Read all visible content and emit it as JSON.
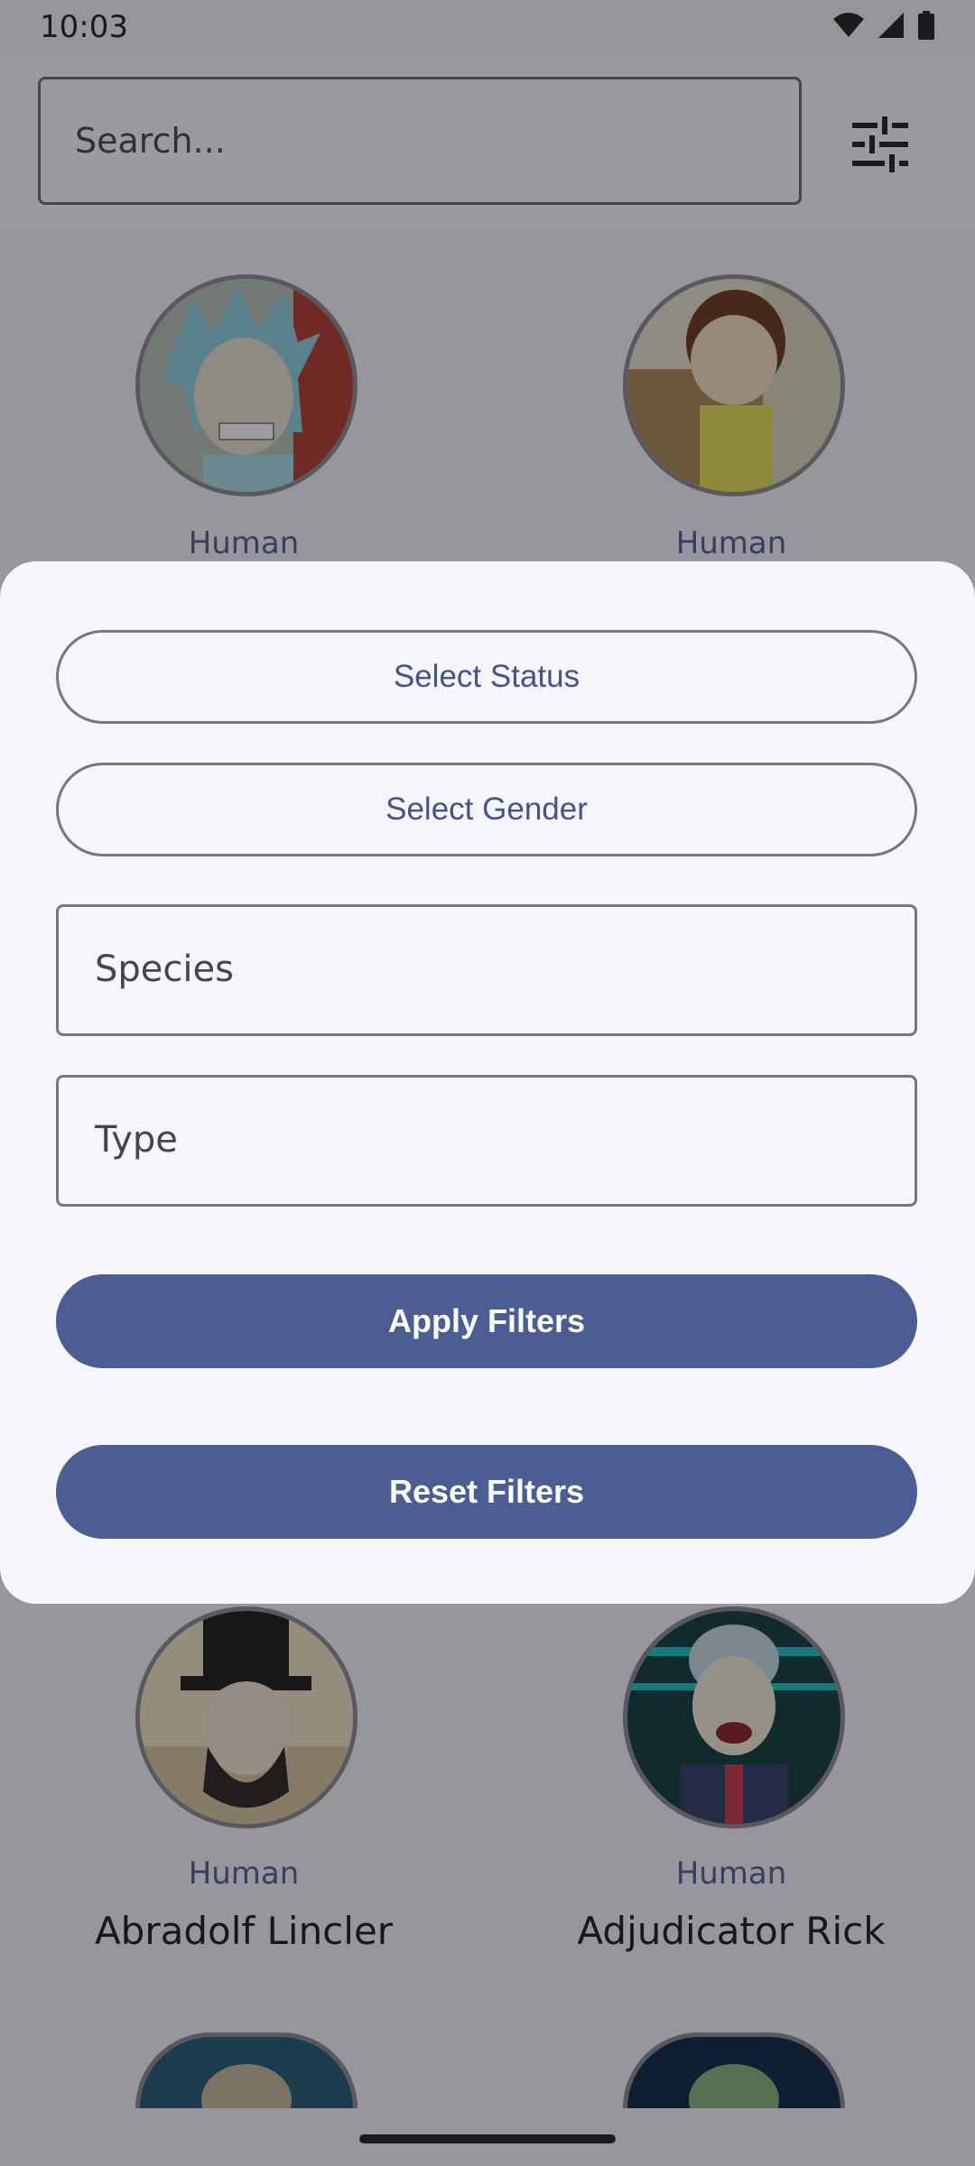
{
  "status_bar": {
    "time": "10:03"
  },
  "search": {
    "placeholder": "Search..."
  },
  "icons": {
    "filter": "tune-icon",
    "wifi": "wifi-icon",
    "signal": "cell-signal-icon",
    "battery": "battery-icon"
  },
  "characters": [
    {
      "species": "Human",
      "name": ""
    },
    {
      "species": "Human",
      "name": ""
    },
    {
      "species": "Human",
      "name": "Abradolf Lincler"
    },
    {
      "species": "Human",
      "name": "Adjudicator Rick"
    }
  ],
  "filter_sheet": {
    "status_label": "Select Status",
    "gender_label": "Select Gender",
    "species_placeholder": "Species",
    "type_placeholder": "Type",
    "apply_label": "Apply Filters",
    "reset_label": "Reset Filters"
  },
  "colors": {
    "primary": "#4b5d93",
    "sheet_bg": "#f7f5fc",
    "outline": "#77767c"
  }
}
